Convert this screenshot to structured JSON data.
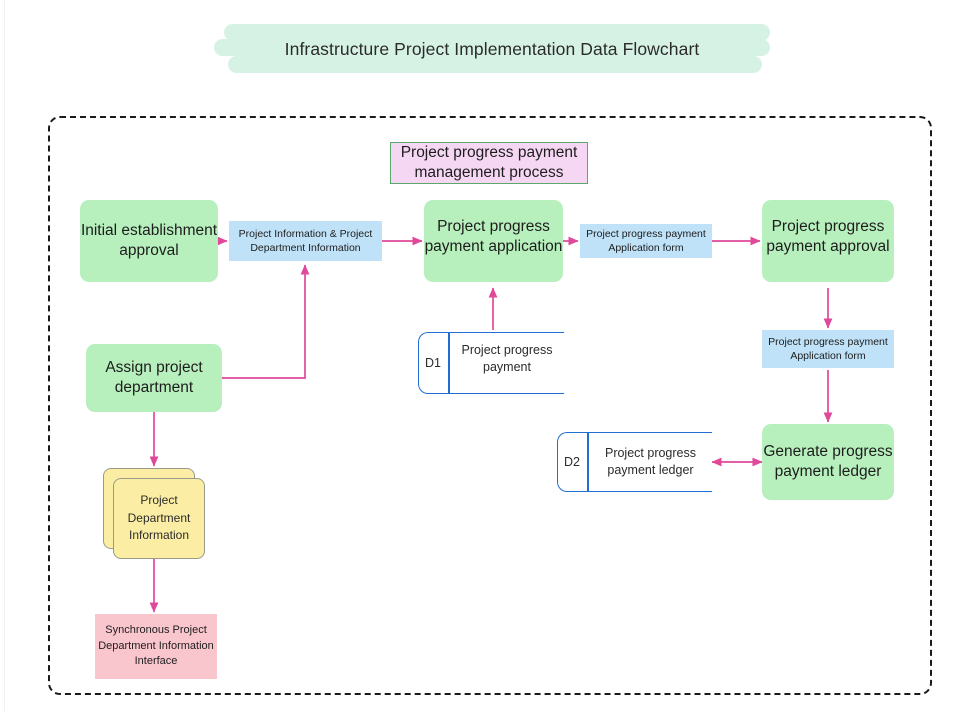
{
  "page": {
    "title": "Infrastructure Project Implementation Data Flowchart",
    "background_color": "#ffffff",
    "title_band_color": "#d6f2e4",
    "frame_border_color": "#1a1a1a",
    "connector_color": "#e0489a"
  },
  "palette": {
    "process_green": "#b7f0bd",
    "dataflow_blue": "#bfe2f8",
    "highlight_pink": "#f6d7f3",
    "highlight_border_green": "#5aa86a",
    "interface_pink": "#fac6ce",
    "document_yellow": "#fbeea4",
    "document_border": "#9a9a8c",
    "datastore_blue": "#1f6fd0"
  },
  "nodes": {
    "highlight_title": {
      "label": "Project progress payment management process",
      "type": "highlighted-process-title"
    },
    "initial_establishment_approval": {
      "label": "Initial establishment approval",
      "type": "process"
    },
    "assign_project_department": {
      "label": "Assign project department",
      "type": "process"
    },
    "project_info_dept_info": {
      "label": "Project Information & Project Department Information",
      "type": "data-flow"
    },
    "payment_application": {
      "label": "Project progress payment application",
      "type": "process"
    },
    "application_form_1": {
      "label": "Project progress payment Application form",
      "type": "data-flow"
    },
    "payment_approval": {
      "label": "Project progress payment approval",
      "type": "process"
    },
    "application_form_2": {
      "label": "Project progress payment Application form",
      "type": "data-flow"
    },
    "generate_ledger": {
      "label": "Generate progress payment ledger",
      "type": "process"
    },
    "datastore_d1": {
      "id": "D1",
      "label": "Project progress payment",
      "type": "data-store"
    },
    "datastore_d2": {
      "id": "D2",
      "label": "Project progress payment ledger",
      "type": "data-store"
    },
    "project_department_information": {
      "label": "Project Department Information",
      "type": "multi-document"
    },
    "sync_interface": {
      "label": "Synchronous Project Department Information Interface",
      "type": "interface"
    }
  },
  "edges": [
    {
      "from": "initial_establishment_approval",
      "to": "project_info_dept_info",
      "direction": "one-way"
    },
    {
      "from": "project_info_dept_info",
      "to": "payment_application",
      "direction": "one-way"
    },
    {
      "from": "payment_application",
      "to": "application_form_1",
      "direction": "one-way"
    },
    {
      "from": "application_form_1",
      "to": "payment_approval",
      "direction": "one-way"
    },
    {
      "from": "assign_project_department",
      "to": "project_info_dept_info",
      "direction": "one-way"
    },
    {
      "from": "datastore_d1",
      "to": "payment_application",
      "direction": "one-way"
    },
    {
      "from": "payment_approval",
      "to": "application_form_2",
      "direction": "one-way"
    },
    {
      "from": "application_form_2",
      "to": "generate_ledger",
      "direction": "one-way"
    },
    {
      "from": "generate_ledger",
      "to": "datastore_d2",
      "direction": "two-way"
    },
    {
      "from": "assign_project_department",
      "to": "project_department_information",
      "direction": "one-way"
    },
    {
      "from": "project_department_information",
      "to": "sync_interface",
      "direction": "one-way"
    }
  ]
}
